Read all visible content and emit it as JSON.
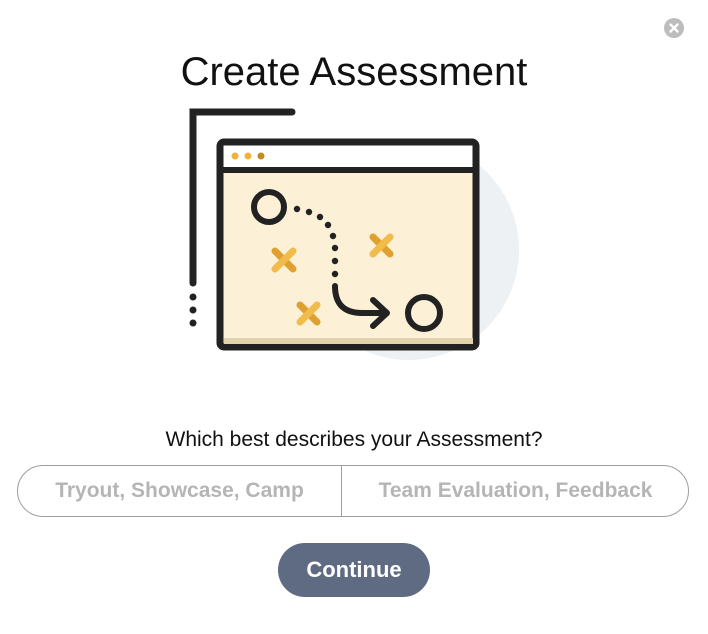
{
  "modal": {
    "title": "Create Assessment",
    "question": "Which best describes your Assessment?",
    "close_icon": "close-circle-icon",
    "options": [
      {
        "label": "Tryout, Showcase, Camp"
      },
      {
        "label": "Team Evaluation, Feedback"
      }
    ],
    "continue_label": "Continue",
    "illustration_icon": "play-strategy-illustration"
  },
  "colors": {
    "continue_button": "#5f6b82",
    "option_text": "#b5b5b5",
    "illustration_board": "#fcf1d6",
    "illustration_accent": "#f0b23a",
    "illustration_circle": "#eef1f3"
  }
}
